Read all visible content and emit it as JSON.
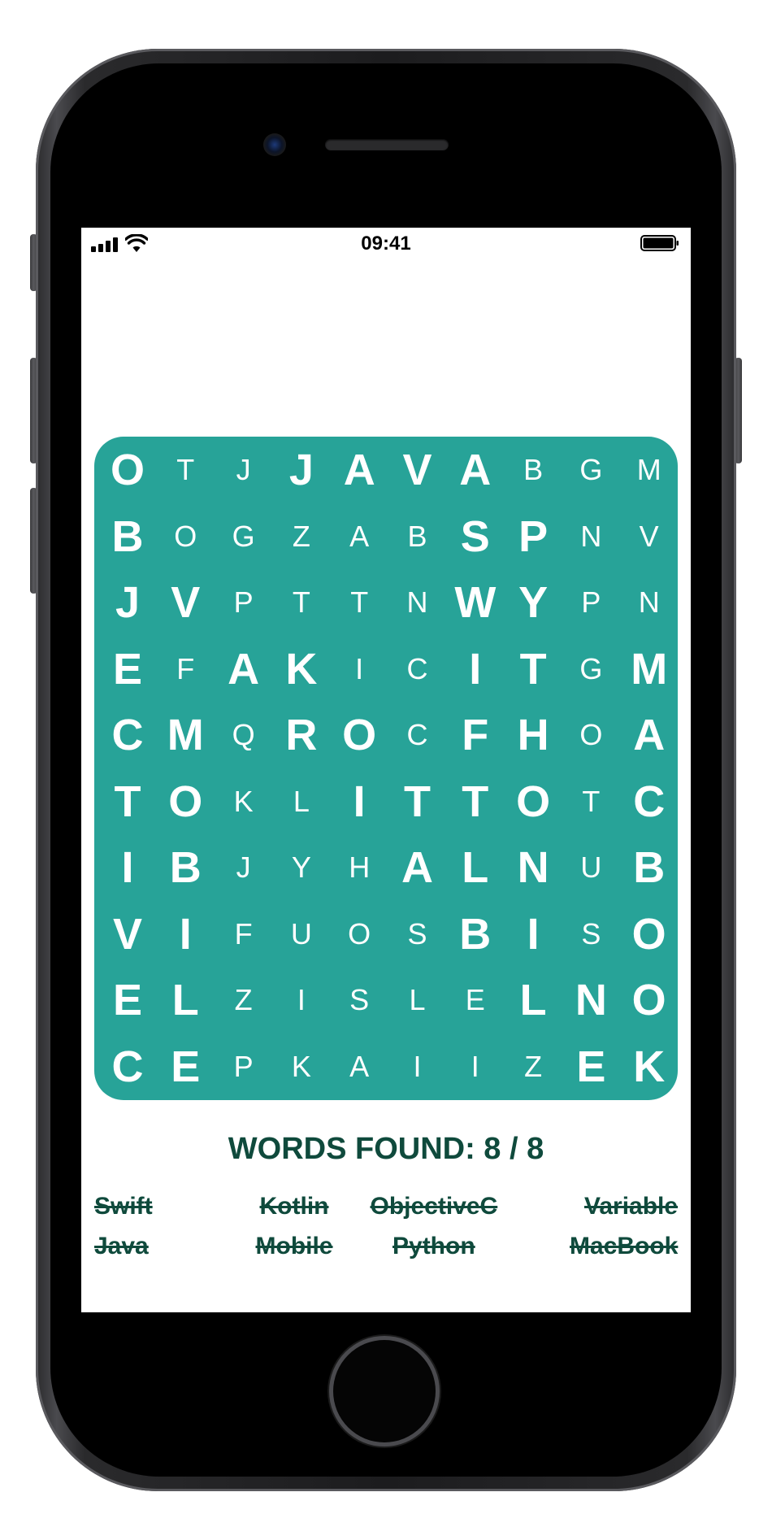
{
  "status_bar": {
    "time": "09:41"
  },
  "puzzle": {
    "rows": [
      [
        [
          "O",
          1
        ],
        [
          "T",
          0
        ],
        [
          "J",
          0
        ],
        [
          "J",
          1
        ],
        [
          "A",
          1
        ],
        [
          "V",
          1
        ],
        [
          "A",
          1
        ],
        [
          "B",
          0
        ],
        [
          "G",
          0
        ],
        [
          "M",
          0
        ]
      ],
      [
        [
          "B",
          1
        ],
        [
          "O",
          0
        ],
        [
          "G",
          0
        ],
        [
          "Z",
          0
        ],
        [
          "A",
          0
        ],
        [
          "B",
          0
        ],
        [
          "S",
          1
        ],
        [
          "P",
          1
        ],
        [
          "N",
          0
        ],
        [
          "V",
          0
        ]
      ],
      [
        [
          "J",
          1
        ],
        [
          "V",
          1
        ],
        [
          "P",
          0
        ],
        [
          "T",
          0
        ],
        [
          "T",
          0
        ],
        [
          "N",
          0
        ],
        [
          "W",
          1
        ],
        [
          "Y",
          1
        ],
        [
          "P",
          0
        ],
        [
          "N",
          0
        ]
      ],
      [
        [
          "E",
          1
        ],
        [
          "F",
          0
        ],
        [
          "A",
          1
        ],
        [
          "K",
          1
        ],
        [
          "I",
          0
        ],
        [
          "C",
          0
        ],
        [
          "I",
          1
        ],
        [
          "T",
          1
        ],
        [
          "G",
          0
        ],
        [
          "M",
          1
        ]
      ],
      [
        [
          "C",
          1
        ],
        [
          "M",
          1
        ],
        [
          "Q",
          0
        ],
        [
          "R",
          1
        ],
        [
          "O",
          1
        ],
        [
          "C",
          0
        ],
        [
          "F",
          1
        ],
        [
          "H",
          1
        ],
        [
          "O",
          0
        ],
        [
          "A",
          1
        ]
      ],
      [
        [
          "T",
          1
        ],
        [
          "O",
          1
        ],
        [
          "K",
          0
        ],
        [
          "L",
          0
        ],
        [
          "I",
          1
        ],
        [
          "T",
          1
        ],
        [
          "T",
          1
        ],
        [
          "O",
          1
        ],
        [
          "T",
          0
        ],
        [
          "C",
          1
        ]
      ],
      [
        [
          "I",
          1
        ],
        [
          "B",
          1
        ],
        [
          "J",
          0
        ],
        [
          "Y",
          0
        ],
        [
          "H",
          0
        ],
        [
          "A",
          1
        ],
        [
          "L",
          1
        ],
        [
          "N",
          1
        ],
        [
          "U",
          0
        ],
        [
          "B",
          1
        ]
      ],
      [
        [
          "V",
          1
        ],
        [
          "I",
          1
        ],
        [
          "F",
          0
        ],
        [
          "U",
          0
        ],
        [
          "O",
          0
        ],
        [
          "S",
          0
        ],
        [
          "B",
          1
        ],
        [
          "I",
          1
        ],
        [
          "S",
          0
        ],
        [
          "O",
          1
        ]
      ],
      [
        [
          "E",
          1
        ],
        [
          "L",
          1
        ],
        [
          "Z",
          0
        ],
        [
          "I",
          0
        ],
        [
          "S",
          0
        ],
        [
          "L",
          0
        ],
        [
          "E",
          0
        ],
        [
          "L",
          1
        ],
        [
          "N",
          1
        ],
        [
          "O",
          1
        ]
      ],
      [
        [
          "C",
          1
        ],
        [
          "E",
          1
        ],
        [
          "P",
          0
        ],
        [
          "K",
          0
        ],
        [
          "A",
          0
        ],
        [
          "I",
          0
        ],
        [
          "I",
          0
        ],
        [
          "Z",
          0
        ],
        [
          "E",
          1
        ],
        [
          "K",
          1
        ]
      ]
    ],
    "board_color": "#27a398",
    "letter_color": "#ffffff"
  },
  "words_found_label": "WORDS FOUND: 8 / 8",
  "words": [
    {
      "text": "Swift",
      "found": true
    },
    {
      "text": "Kotlin",
      "found": true
    },
    {
      "text": "ObjectiveC",
      "found": true
    },
    {
      "text": "Variable",
      "found": true
    },
    {
      "text": "Java",
      "found": true
    },
    {
      "text": "Mobile",
      "found": true
    },
    {
      "text": "Python",
      "found": true
    },
    {
      "text": "MacBook",
      "found": true
    }
  ],
  "text_color": "#0f4a3c"
}
